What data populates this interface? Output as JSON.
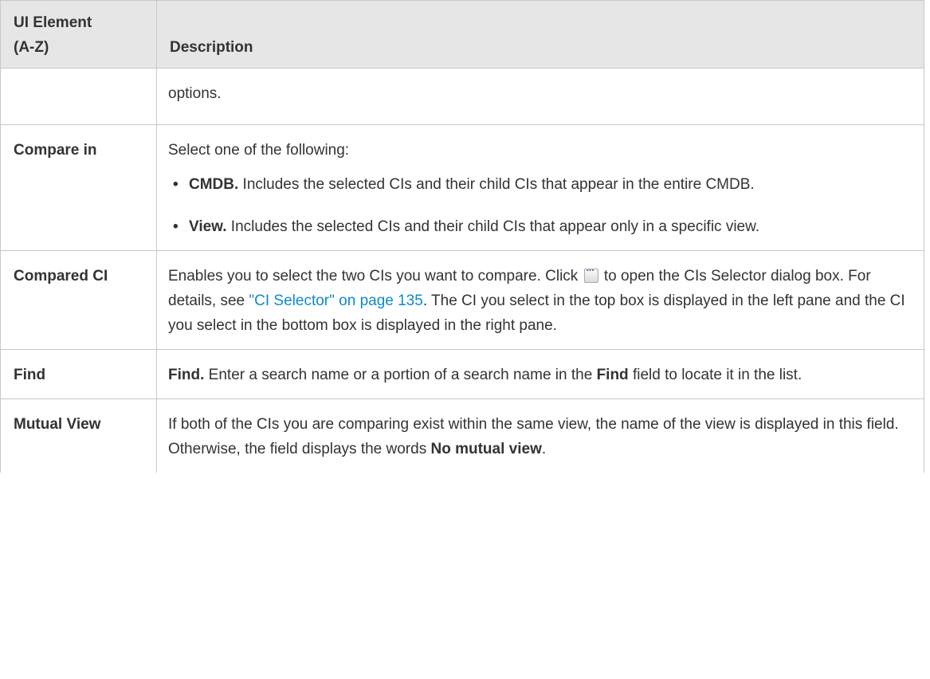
{
  "header": {
    "col1_line1": "UI Element",
    "col1_line2": "(A-Z)",
    "col2": "Description"
  },
  "rows": {
    "continued": {
      "desc": "options."
    },
    "compare_in": {
      "name": "Compare in",
      "intro": "Select one of the following:",
      "options": [
        {
          "term": "CMDB.",
          "text": " Includes the selected CIs and their child CIs that appear in the entire CMDB."
        },
        {
          "term": "View.",
          "text": " Includes the selected CIs and their child CIs that appear only in a specific view."
        }
      ]
    },
    "compared_ci": {
      "name": "Compared CI",
      "text1": "Enables you to select the two CIs you want to compare. Click ",
      "icon": "browse-ellipsis-icon",
      "text2": " to open the CIs Selector dialog box. For details, see ",
      "link": "\"CI Selector\" on page 135",
      "text3": ". The CI you select in the top box is displayed in the left pane and the CI you select in the bottom box is displayed in the right pane."
    },
    "find": {
      "name": "Find",
      "term": "Find.",
      "text1": " Enter a search name or a portion of a search name in the ",
      "field": "Find",
      "text2": " field to locate it in the list."
    },
    "mutual_view": {
      "name": "Mutual View",
      "text1": "If both of the CIs you are comparing exist within the same view, the name of the view is displayed in this field. Otherwise, the field displays the words ",
      "words": "No mutual view",
      "text2": "."
    }
  },
  "colors": {
    "header_bg": "#e6e6e6",
    "border": "#c8c8c8",
    "link": "#0e8ac8",
    "text": "#333333"
  }
}
